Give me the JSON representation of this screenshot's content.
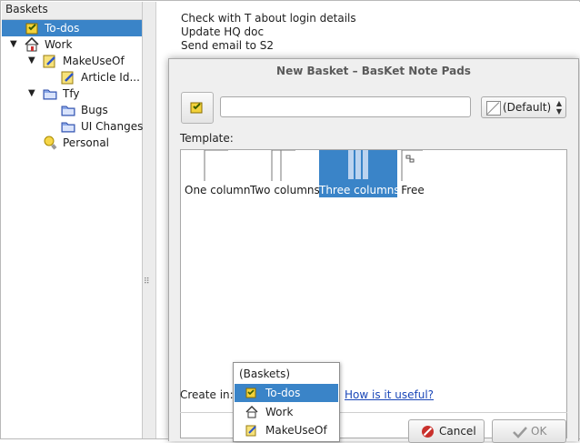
{
  "tree": {
    "header": "Baskets",
    "items": [
      {
        "label": "To-dos",
        "icon": "todo-basket-icon"
      },
      {
        "label": "Work",
        "icon": "house-icon"
      },
      {
        "label": "MakeUseOf",
        "icon": "pencil-note-icon"
      },
      {
        "label": "Article Id...",
        "icon": "pencil-note-icon"
      },
      {
        "label": "Tfy",
        "icon": "folder-icon"
      },
      {
        "label": "Bugs",
        "icon": "folder-icon"
      },
      {
        "label": "UI Changes",
        "icon": "folder-icon"
      },
      {
        "label": "Personal",
        "icon": "lightbulb-icon"
      }
    ],
    "splitter_grip": "⠿"
  },
  "notes": {
    "lines": [
      "Check with T about login details",
      "Update HQ doc",
      "Send email to S2"
    ]
  },
  "dialog": {
    "title": "New Basket – BasKet Note Pads",
    "name_value": "",
    "color_value": "(Default)",
    "template_label": "Template:",
    "templates": [
      "One column",
      "Two columns",
      "Three columns",
      "Free"
    ],
    "selected_template": "Three columns",
    "create_in_label": "Create in:",
    "useful_link": "How is it useful?",
    "cancel_label": "Cancel",
    "ok_label": "OK"
  },
  "popup": {
    "header": "(Baskets)",
    "items": [
      {
        "label": "To-dos",
        "icon": "todo-basket-icon"
      },
      {
        "label": "Work",
        "icon": "house-icon"
      },
      {
        "label": "MakeUseOf",
        "icon": "pencil-note-icon"
      }
    ]
  },
  "colors": {
    "selection": "#3a84c8",
    "link": "#1a47b8",
    "dialog_bg": "#efefef"
  }
}
